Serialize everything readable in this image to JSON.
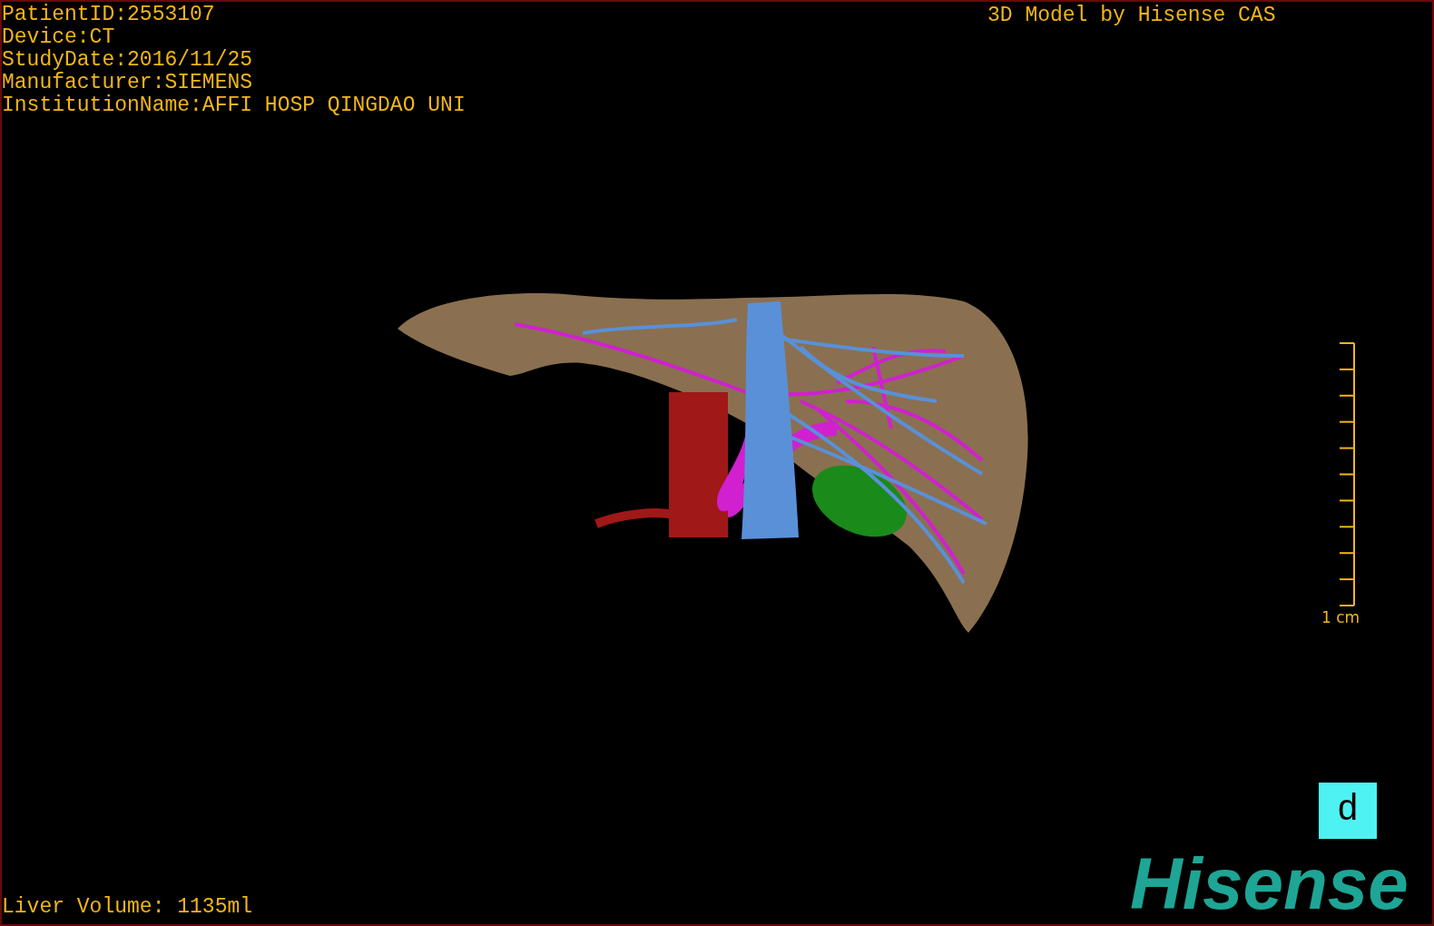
{
  "info_lines": [
    "PatientID:2553107",
    "Device:CT",
    "StudyDate:2016/11/25",
    "Manufacturer:SIEMENS",
    "InstitutionName:AFFI HOSP QINGDAO UNI"
  ],
  "title": "3D Model by Hisense CAS",
  "scale_bar": {
    "label": "1 cm"
  },
  "view_button": {
    "label": "d"
  },
  "logo": {
    "text": "Hisense"
  },
  "liver_volume": "Liver Volume: 1135ml"
}
